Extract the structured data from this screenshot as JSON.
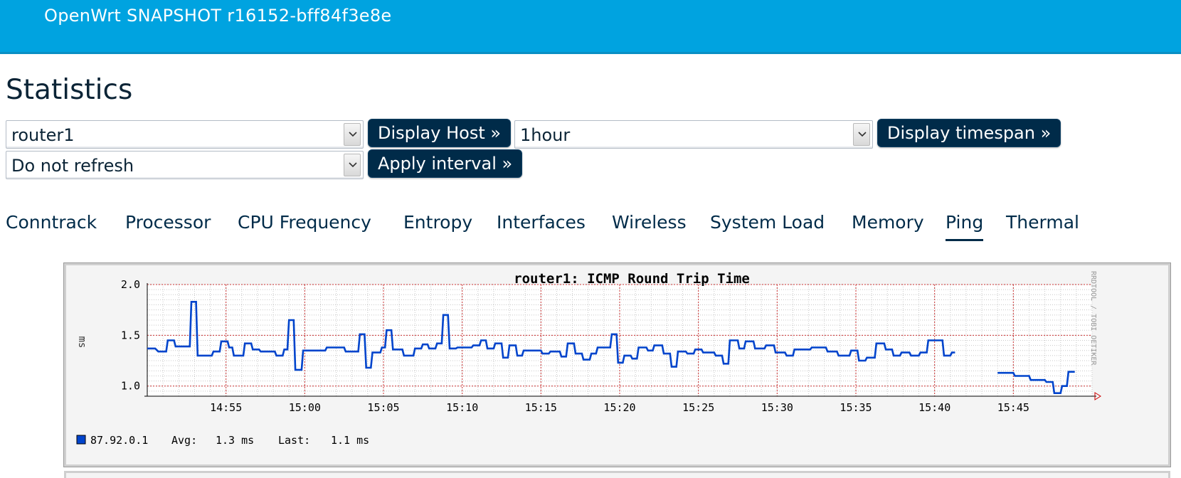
{
  "header": {
    "brand": "OpenWrt SNAPSHOT r16152-bff84f3e8e"
  },
  "page": {
    "title": "Statistics"
  },
  "controls": {
    "host_select": "router1",
    "display_host_label": "Display Host »",
    "timespan_select": "1hour",
    "display_timespan_label": "Display timespan »",
    "refresh_select": "Do not refresh",
    "apply_interval_label": "Apply interval »"
  },
  "tabs": [
    {
      "label": "Conntrack"
    },
    {
      "label": "Processor"
    },
    {
      "label": "CPU Frequency"
    },
    {
      "label": "Entropy"
    },
    {
      "label": "Interfaces"
    },
    {
      "label": "Wireless"
    },
    {
      "label": "System Load"
    },
    {
      "label": "Memory"
    },
    {
      "label": "Ping",
      "active": true
    },
    {
      "label": "Thermal"
    }
  ],
  "chart_data": {
    "type": "line",
    "title": "router1: ICMP Round Trip Time",
    "ylabel": "ms",
    "side_label": "RRDTOOL / TOBI OETIKER",
    "ylim": [
      0.9,
      2.0
    ],
    "y_ticks": [
      "2.0",
      "1.5",
      "1.0"
    ],
    "x_ticks": [
      "14:55",
      "15:00",
      "15:05",
      "15:10",
      "15:15",
      "15:20",
      "15:25",
      "15:30",
      "15:35",
      "15:40",
      "15:45"
    ],
    "x_tick_minutes": [
      55,
      60,
      65,
      70,
      75,
      80,
      85,
      90,
      95,
      100,
      105
    ],
    "xlim_minutes": [
      50.0,
      110.0
    ],
    "grid": true,
    "series": [
      {
        "name": "87.92.0.1",
        "color": "#0044cc",
        "points": [
          [
            50.0,
            1.37
          ],
          [
            50.5,
            1.37
          ],
          [
            50.7,
            1.34
          ],
          [
            51.2,
            1.34
          ],
          [
            51.3,
            1.45
          ],
          [
            51.7,
            1.45
          ],
          [
            51.8,
            1.39
          ],
          [
            52.7,
            1.39
          ],
          [
            52.8,
            1.83
          ],
          [
            53.1,
            1.83
          ],
          [
            53.2,
            1.3
          ],
          [
            54.1,
            1.3
          ],
          [
            54.2,
            1.34
          ],
          [
            54.6,
            1.34
          ],
          [
            54.7,
            1.44
          ],
          [
            55.1,
            1.44
          ],
          [
            55.2,
            1.38
          ],
          [
            55.4,
            1.38
          ],
          [
            55.5,
            1.3
          ],
          [
            56.1,
            1.3
          ],
          [
            56.2,
            1.42
          ],
          [
            56.6,
            1.42
          ],
          [
            56.7,
            1.36
          ],
          [
            57.1,
            1.36
          ],
          [
            57.2,
            1.34
          ],
          [
            58.1,
            1.34
          ],
          [
            58.2,
            1.3
          ],
          [
            58.6,
            1.3
          ],
          [
            58.7,
            1.36
          ],
          [
            58.9,
            1.36
          ],
          [
            59.0,
            1.65
          ],
          [
            59.3,
            1.65
          ],
          [
            59.4,
            1.16
          ],
          [
            59.8,
            1.16
          ],
          [
            59.9,
            1.35
          ],
          [
            61.3,
            1.35
          ],
          [
            61.4,
            1.38
          ],
          [
            62.5,
            1.38
          ],
          [
            62.6,
            1.34
          ],
          [
            63.4,
            1.34
          ],
          [
            63.5,
            1.51
          ],
          [
            63.8,
            1.51
          ],
          [
            63.9,
            1.18
          ],
          [
            64.2,
            1.18
          ],
          [
            64.3,
            1.33
          ],
          [
            64.8,
            1.33
          ],
          [
            64.9,
            1.38
          ],
          [
            65.1,
            1.38
          ],
          [
            65.2,
            1.55
          ],
          [
            65.5,
            1.55
          ],
          [
            65.6,
            1.36
          ],
          [
            66.2,
            1.36
          ],
          [
            66.3,
            1.3
          ],
          [
            66.9,
            1.3
          ],
          [
            67.0,
            1.37
          ],
          [
            67.4,
            1.37
          ],
          [
            67.5,
            1.41
          ],
          [
            67.8,
            1.41
          ],
          [
            67.9,
            1.37
          ],
          [
            68.3,
            1.37
          ],
          [
            68.4,
            1.42
          ],
          [
            68.7,
            1.42
          ],
          [
            68.8,
            1.7
          ],
          [
            69.1,
            1.7
          ],
          [
            69.2,
            1.37
          ],
          [
            69.6,
            1.37
          ],
          [
            69.7,
            1.38
          ],
          [
            70.6,
            1.38
          ],
          [
            70.7,
            1.4
          ],
          [
            71.1,
            1.4
          ],
          [
            71.2,
            1.45
          ],
          [
            71.5,
            1.45
          ],
          [
            71.6,
            1.37
          ],
          [
            72.0,
            1.37
          ],
          [
            72.1,
            1.42
          ],
          [
            72.5,
            1.42
          ],
          [
            72.6,
            1.28
          ],
          [
            72.9,
            1.28
          ],
          [
            73.0,
            1.4
          ],
          [
            73.4,
            1.4
          ],
          [
            73.5,
            1.3
          ],
          [
            73.8,
            1.3
          ],
          [
            73.9,
            1.35
          ],
          [
            75.0,
            1.35
          ],
          [
            75.1,
            1.32
          ],
          [
            75.5,
            1.32
          ],
          [
            75.6,
            1.34
          ],
          [
            76.2,
            1.34
          ],
          [
            76.3,
            1.29
          ],
          [
            76.6,
            1.29
          ],
          [
            76.7,
            1.42
          ],
          [
            77.1,
            1.42
          ],
          [
            77.2,
            1.32
          ],
          [
            77.6,
            1.32
          ],
          [
            77.7,
            1.26
          ],
          [
            78.1,
            1.26
          ],
          [
            78.2,
            1.32
          ],
          [
            78.5,
            1.32
          ],
          [
            78.6,
            1.38
          ],
          [
            79.4,
            1.38
          ],
          [
            79.5,
            1.51
          ],
          [
            79.8,
            1.51
          ],
          [
            79.9,
            1.23
          ],
          [
            80.2,
            1.23
          ],
          [
            80.3,
            1.3
          ],
          [
            80.7,
            1.3
          ],
          [
            80.8,
            1.27
          ],
          [
            81.1,
            1.27
          ],
          [
            81.2,
            1.38
          ],
          [
            81.7,
            1.38
          ],
          [
            81.8,
            1.35
          ],
          [
            82.1,
            1.35
          ],
          [
            82.2,
            1.4
          ],
          [
            82.7,
            1.4
          ],
          [
            82.8,
            1.32
          ],
          [
            83.2,
            1.32
          ],
          [
            83.3,
            1.19
          ],
          [
            83.6,
            1.19
          ],
          [
            83.7,
            1.34
          ],
          [
            84.2,
            1.34
          ],
          [
            84.3,
            1.32
          ],
          [
            84.7,
            1.32
          ],
          [
            84.8,
            1.36
          ],
          [
            85.2,
            1.36
          ],
          [
            85.3,
            1.33
          ],
          [
            86.0,
            1.33
          ],
          [
            86.1,
            1.3
          ],
          [
            86.5,
            1.3
          ],
          [
            86.6,
            1.22
          ],
          [
            86.9,
            1.22
          ],
          [
            87.0,
            1.45
          ],
          [
            87.5,
            1.45
          ],
          [
            87.6,
            1.37
          ],
          [
            87.9,
            1.37
          ],
          [
            88.0,
            1.44
          ],
          [
            88.5,
            1.44
          ],
          [
            88.6,
            1.37
          ],
          [
            89.2,
            1.37
          ],
          [
            89.3,
            1.4
          ],
          [
            89.8,
            1.4
          ],
          [
            89.9,
            1.33
          ],
          [
            90.5,
            1.33
          ],
          [
            90.6,
            1.3
          ],
          [
            91.0,
            1.3
          ],
          [
            91.1,
            1.36
          ],
          [
            92.1,
            1.36
          ],
          [
            92.2,
            1.38
          ],
          [
            93.1,
            1.38
          ],
          [
            93.2,
            1.34
          ],
          [
            93.8,
            1.34
          ],
          [
            93.9,
            1.3
          ],
          [
            94.6,
            1.3
          ],
          [
            94.7,
            1.35
          ],
          [
            95.1,
            1.35
          ],
          [
            95.2,
            1.25
          ],
          [
            95.6,
            1.25
          ],
          [
            95.7,
            1.28
          ],
          [
            96.2,
            1.28
          ],
          [
            96.3,
            1.42
          ],
          [
            96.8,
            1.42
          ],
          [
            96.9,
            1.36
          ],
          [
            97.3,
            1.36
          ],
          [
            97.4,
            1.3
          ],
          [
            97.8,
            1.3
          ],
          [
            97.9,
            1.33
          ],
          [
            98.4,
            1.33
          ],
          [
            98.5,
            1.3
          ],
          [
            99.0,
            1.3
          ],
          [
            99.1,
            1.33
          ],
          [
            99.5,
            1.33
          ],
          [
            99.6,
            1.45
          ],
          [
            100.5,
            1.45
          ],
          [
            100.6,
            1.3
          ],
          [
            101.0,
            1.3
          ],
          [
            101.1,
            1.33
          ],
          [
            101.3,
            1.33
          ],
          null,
          [
            104.0,
            1.13
          ],
          [
            105.0,
            1.13
          ],
          [
            105.1,
            1.1
          ],
          [
            106.0,
            1.1
          ],
          [
            106.1,
            1.06
          ],
          [
            107.0,
            1.06
          ],
          [
            107.1,
            1.04
          ],
          [
            107.5,
            1.04
          ],
          [
            107.6,
            0.93
          ],
          [
            108.0,
            0.93
          ],
          [
            108.1,
            1.0
          ],
          [
            108.4,
            1.0
          ],
          [
            108.5,
            1.14
          ],
          [
            108.9,
            1.14
          ]
        ]
      }
    ],
    "legend": {
      "host": "87.92.0.1",
      "avg_label": "Avg:",
      "avg_value": "1.3 ms",
      "last_label": "Last:",
      "last_value": "1.1 ms"
    }
  }
}
